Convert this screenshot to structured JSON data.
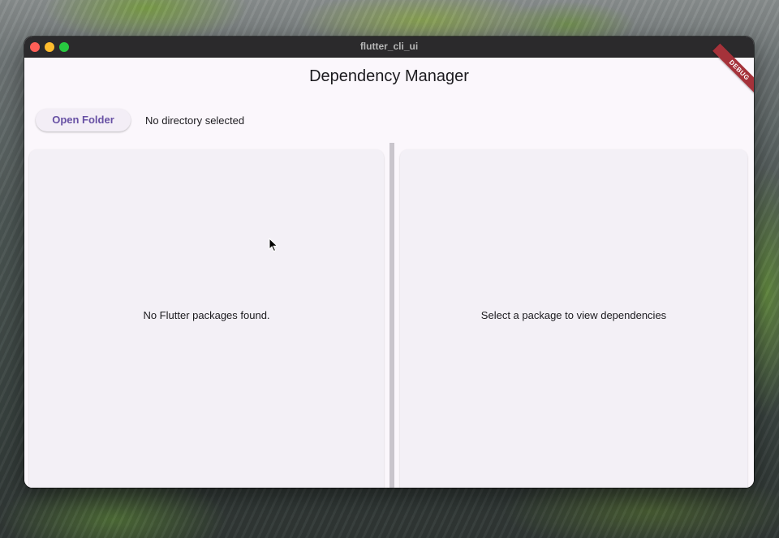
{
  "window": {
    "title": "flutter_cli_ui"
  },
  "app": {
    "title": "Dependency Manager",
    "debug_banner": "DEBUG"
  },
  "toolbar": {
    "open_folder_label": "Open Folder",
    "directory_status": "No directory selected"
  },
  "packages_panel": {
    "empty_message": "No Flutter packages found."
  },
  "dependencies_panel": {
    "empty_message": "Select a package to view dependencies"
  },
  "colors": {
    "accent": "#6750a4",
    "background": "#fbf7fc",
    "panel": "#f3f0f6",
    "debug_ribbon": "#a5323a"
  },
  "icons": [
    "close-icon",
    "minimize-icon",
    "maximize-icon",
    "mouse-cursor-icon"
  ]
}
